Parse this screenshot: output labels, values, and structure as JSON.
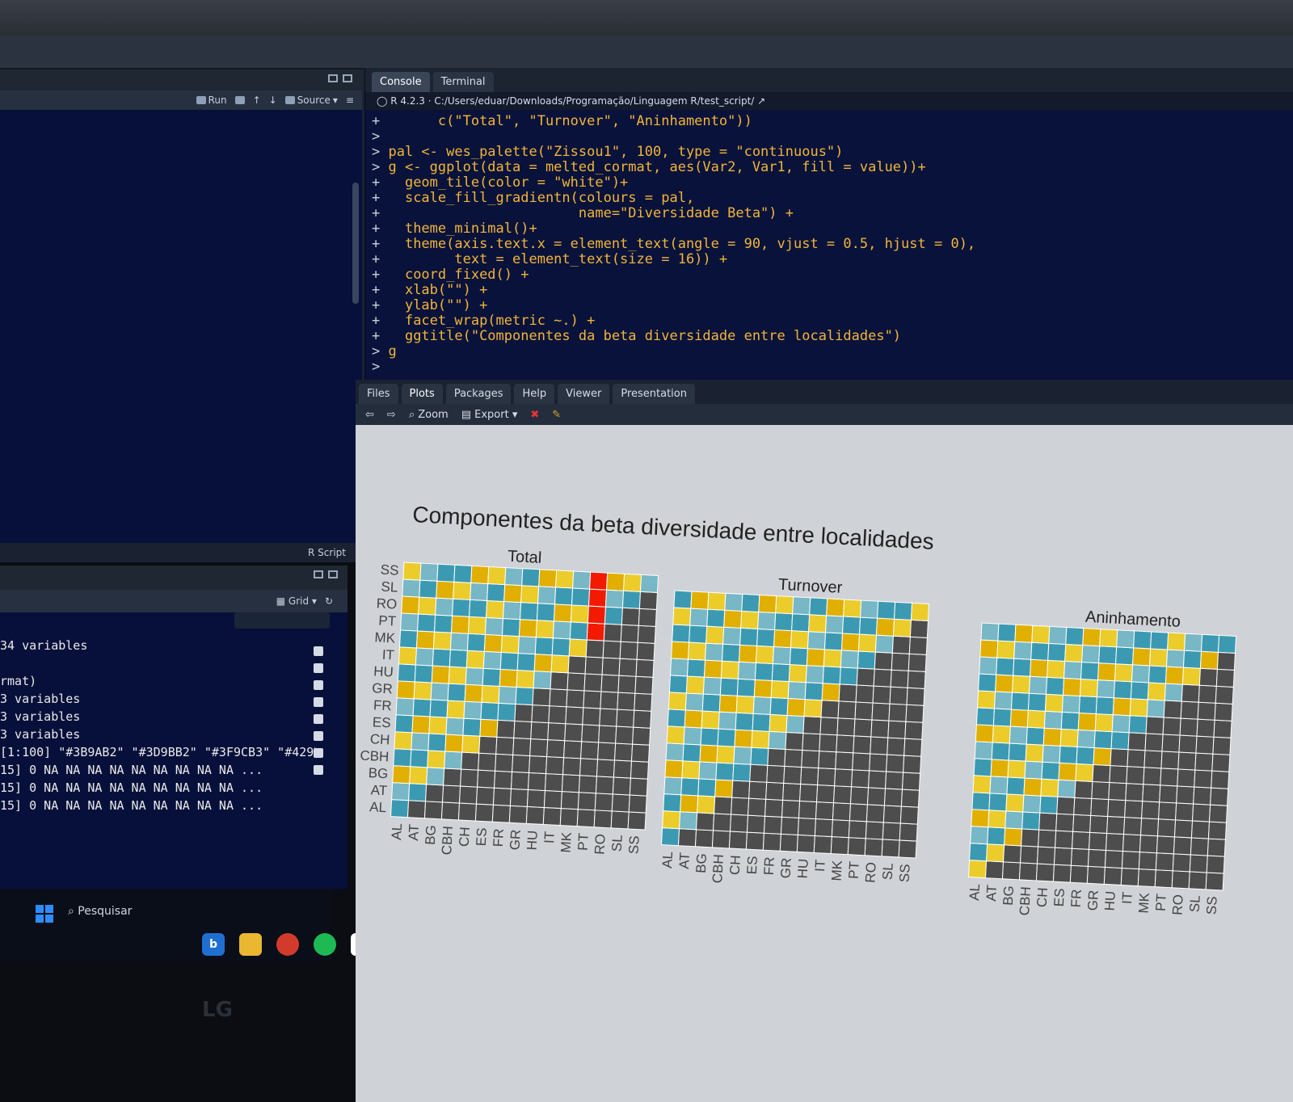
{
  "editor": {
    "run_label": "Run",
    "source_label": "Source",
    "status_label": "R Script"
  },
  "env": {
    "view_label": "Grid",
    "lines": [
      "34 variables",
      "",
      "rmat)",
      "3 variables",
      "3 variables",
      "3 variables",
      "[1:100] \"#3B9AB2\" \"#3D9BB2\" \"#3F9CB3\" \"#429D...",
      "15] 0 NA NA NA NA NA NA NA NA NA ...",
      "15] 0 NA NA NA NA NA NA NA NA NA ...",
      "15] 0 NA NA NA NA NA NA NA NA NA ..."
    ]
  },
  "taskbar": {
    "search_label": "Pesquisar",
    "brand": "LG"
  },
  "console": {
    "tabs": [
      "Console",
      "Terminal"
    ],
    "r_version": "R 4.2.3",
    "path": "C:/Users/eduar/Downloads/Programação/Linguagem R/test_script/",
    "lines": [
      {
        "prompt": "+",
        "text": "      c(\"Total\", \"Turnover\", \"Aninhamento\"))"
      },
      {
        "prompt": ">",
        "text": ""
      },
      {
        "prompt": ">",
        "text": "pal <- wes_palette(\"Zissou1\", 100, type = \"continuous\")"
      },
      {
        "prompt": ">",
        "text": "g <- ggplot(data = melted_cormat, aes(Var2, Var1, fill = value))+"
      },
      {
        "prompt": "+",
        "text": "  geom_tile(color = \"white\")+"
      },
      {
        "prompt": "+",
        "text": "  scale_fill_gradientn(colours = pal,"
      },
      {
        "prompt": "+",
        "text": "                       name=\"Diversidade Beta\") +"
      },
      {
        "prompt": "+",
        "text": "  theme_minimal()+"
      },
      {
        "prompt": "+",
        "text": "  theme(axis.text.x = element_text(angle = 90, vjust = 0.5, hjust = 0),"
      },
      {
        "prompt": "+",
        "text": "        text = element_text(size = 16)) +"
      },
      {
        "prompt": "+",
        "text": "  coord_fixed() +"
      },
      {
        "prompt": "+",
        "text": "  xlab(\"\") +"
      },
      {
        "prompt": "+",
        "text": "  ylab(\"\") +"
      },
      {
        "prompt": "+",
        "text": "  facet_wrap(metric ~.) +"
      },
      {
        "prompt": "+",
        "text": "  ggtitle(\"Componentes da beta diversidade entre localidades\")"
      },
      {
        "prompt": ">",
        "text": "g"
      },
      {
        "prompt": ">",
        "text": ""
      }
    ]
  },
  "plots": {
    "tabs": [
      "Files",
      "Plots",
      "Packages",
      "Help",
      "Viewer",
      "Presentation"
    ],
    "zoom_label": "Zoom",
    "export_label": "Export"
  },
  "chart_data": {
    "type": "heatmap",
    "title": "Componentes da beta diversidade entre localidades",
    "facets": [
      "Total",
      "Turnover",
      "Aninhamento"
    ],
    "categories": [
      "AL",
      "AT",
      "BG",
      "CBH",
      "CH",
      "ES",
      "FR",
      "GR",
      "HU",
      "IT",
      "MK",
      "PT",
      "RO",
      "SL",
      "SS"
    ],
    "palette": [
      "#3B9AB2",
      "#78B7C5",
      "#EBCC2A",
      "#E1AF00",
      "#F21A00"
    ],
    "empty_color": "#4d4d4d",
    "note": "Values are lower-triangular beta diversity components; upper triangle is NA (grey)."
  }
}
